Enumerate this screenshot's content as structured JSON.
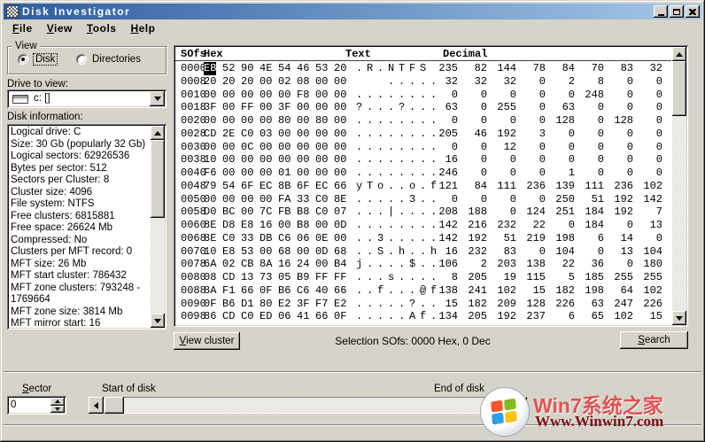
{
  "window": {
    "title": "Disk Investigator"
  },
  "colors": {
    "titlebar_left": "#2d5c9e",
    "titlebar_right": "#a6c8e8",
    "face": "#d6d3ca",
    "selection_bg": "#000000",
    "selection_fg": "#ffffff",
    "watermark_red": "#e05252",
    "watermark_dark_red": "#7b1418"
  },
  "menu": {
    "items": [
      {
        "label": "File"
      },
      {
        "label": "View"
      },
      {
        "label": "Tools"
      },
      {
        "label": "Help"
      }
    ]
  },
  "view_group": {
    "title": "View",
    "options": [
      {
        "label": "Disk",
        "selected": true
      },
      {
        "label": "Directories",
        "selected": false
      }
    ]
  },
  "drive": {
    "label": "Drive to view:",
    "value": "c: []",
    "icon": "drive-icon"
  },
  "disk_info": {
    "label": "Disk information:",
    "lines": [
      "Logical drive: C",
      "Size: 30 Gb (popularly 32 Gb)",
      "Logical sectors: 62926536",
      "Bytes per sector: 512",
      "Sectors per Cluster: 8",
      "Cluster size: 4096",
      "File system: NTFS",
      "Free clusters: 6815881",
      "Free space: 26624 Mb",
      "Compressed: No",
      "Clusters per MFT record: 0",
      "MFT size: 26 Mb",
      "MFT start cluster: 786432",
      "MFT zone clusters: 793248 - 1769664",
      "MFT zone size: 3814 Mb",
      "MFT mirror start: 16"
    ]
  },
  "hexview": {
    "headers": {
      "sofs": "SOfs",
      "hex": "Hex",
      "text": "Text",
      "decimal": "Decimal"
    },
    "selected": {
      "row": 0,
      "col": 0
    },
    "rows": [
      {
        "sofs": "0000",
        "hex": [
          "EB",
          "52",
          "90",
          "4E",
          "54",
          "46",
          "53",
          "20"
        ],
        "text": [
          ".",
          "R",
          ".",
          "N",
          "T",
          "F",
          "S",
          " "
        ],
        "dec": [
          "235",
          "82",
          "144",
          "78",
          "84",
          "70",
          "83",
          "32"
        ]
      },
      {
        "sofs": "0008",
        "hex": [
          "20",
          "20",
          "20",
          "00",
          "02",
          "08",
          "00",
          "00"
        ],
        "text": [
          " ",
          " ",
          " ",
          ".",
          ".",
          ".",
          ".",
          "."
        ],
        "dec": [
          "32",
          "32",
          "32",
          "0",
          "2",
          "8",
          "0",
          "0"
        ]
      },
      {
        "sofs": "0010",
        "hex": [
          "00",
          "00",
          "00",
          "00",
          "00",
          "F8",
          "00",
          "00"
        ],
        "text": [
          ".",
          ".",
          ".",
          ".",
          ".",
          ".",
          ".",
          "."
        ],
        "dec": [
          "0",
          "0",
          "0",
          "0",
          "0",
          "248",
          "0",
          "0"
        ]
      },
      {
        "sofs": "0018",
        "hex": [
          "3F",
          "00",
          "FF",
          "00",
          "3F",
          "00",
          "00",
          "00"
        ],
        "text": [
          "?",
          ".",
          ".",
          ".",
          "?",
          ".",
          ".",
          "."
        ],
        "dec": [
          "63",
          "0",
          "255",
          "0",
          "63",
          "0",
          "0",
          "0"
        ]
      },
      {
        "sofs": "0020",
        "hex": [
          "00",
          "00",
          "00",
          "00",
          "80",
          "00",
          "80",
          "00"
        ],
        "text": [
          ".",
          ".",
          ".",
          ".",
          ".",
          ".",
          ".",
          "."
        ],
        "dec": [
          "0",
          "0",
          "0",
          "0",
          "128",
          "0",
          "128",
          "0"
        ]
      },
      {
        "sofs": "0028",
        "hex": [
          "CD",
          "2E",
          "C0",
          "03",
          "00",
          "00",
          "00",
          "00"
        ],
        "text": [
          ".",
          ".",
          ".",
          ".",
          ".",
          ".",
          ".",
          "."
        ],
        "dec": [
          "205",
          "46",
          "192",
          "3",
          "0",
          "0",
          "0",
          "0"
        ]
      },
      {
        "sofs": "0030",
        "hex": [
          "00",
          "00",
          "0C",
          "00",
          "00",
          "00",
          "00",
          "00"
        ],
        "text": [
          ".",
          ".",
          ".",
          ".",
          ".",
          ".",
          ".",
          "."
        ],
        "dec": [
          "0",
          "0",
          "12",
          "0",
          "0",
          "0",
          "0",
          "0"
        ]
      },
      {
        "sofs": "0038",
        "hex": [
          "10",
          "00",
          "00",
          "00",
          "00",
          "00",
          "00",
          "00"
        ],
        "text": [
          ".",
          ".",
          ".",
          ".",
          ".",
          ".",
          ".",
          "."
        ],
        "dec": [
          "16",
          "0",
          "0",
          "0",
          "0",
          "0",
          "0",
          "0"
        ]
      },
      {
        "sofs": "0040",
        "hex": [
          "F6",
          "00",
          "00",
          "00",
          "01",
          "00",
          "00",
          "00"
        ],
        "text": [
          ".",
          ".",
          ".",
          ".",
          ".",
          ".",
          ".",
          "."
        ],
        "dec": [
          "246",
          "0",
          "0",
          "0",
          "1",
          "0",
          "0",
          "0"
        ]
      },
      {
        "sofs": "0048",
        "hex": [
          "79",
          "54",
          "6F",
          "EC",
          "8B",
          "6F",
          "EC",
          "66"
        ],
        "text": [
          "y",
          "T",
          "o",
          ".",
          ".",
          "o",
          ".",
          "f"
        ],
        "dec": [
          "121",
          "84",
          "111",
          "236",
          "139",
          "111",
          "236",
          "102"
        ]
      },
      {
        "sofs": "0050",
        "hex": [
          "00",
          "00",
          "00",
          "00",
          "FA",
          "33",
          "C0",
          "8E"
        ],
        "text": [
          ".",
          ".",
          ".",
          ".",
          ".",
          "3",
          ".",
          "."
        ],
        "dec": [
          "0",
          "0",
          "0",
          "0",
          "250",
          "51",
          "192",
          "142"
        ]
      },
      {
        "sofs": "0058",
        "hex": [
          "D0",
          "BC",
          "00",
          "7C",
          "FB",
          "B8",
          "C0",
          "07"
        ],
        "text": [
          ".",
          ".",
          ".",
          "|",
          ".",
          ".",
          ".",
          "."
        ],
        "dec": [
          "208",
          "188",
          "0",
          "124",
          "251",
          "184",
          "192",
          "7"
        ]
      },
      {
        "sofs": "0060",
        "hex": [
          "8E",
          "D8",
          "E8",
          "16",
          "00",
          "B8",
          "00",
          "0D"
        ],
        "text": [
          ".",
          ".",
          ".",
          ".",
          ".",
          ".",
          ".",
          "."
        ],
        "dec": [
          "142",
          "216",
          "232",
          "22",
          "0",
          "184",
          "0",
          "13"
        ]
      },
      {
        "sofs": "0068",
        "hex": [
          "8E",
          "C0",
          "33",
          "DB",
          "C6",
          "06",
          "0E",
          "00"
        ],
        "text": [
          ".",
          ".",
          "3",
          ".",
          ".",
          ".",
          ".",
          "."
        ],
        "dec": [
          "142",
          "192",
          "51",
          "219",
          "198",
          "6",
          "14",
          "0"
        ]
      },
      {
        "sofs": "0070",
        "hex": [
          "10",
          "E8",
          "53",
          "00",
          "68",
          "00",
          "0D",
          "68"
        ],
        "text": [
          ".",
          ".",
          "S",
          ".",
          "h",
          ".",
          ".",
          "h"
        ],
        "dec": [
          "16",
          "232",
          "83",
          "0",
          "104",
          "0",
          "13",
          "104"
        ]
      },
      {
        "sofs": "0078",
        "hex": [
          "6A",
          "02",
          "CB",
          "8A",
          "16",
          "24",
          "00",
          "B4"
        ],
        "text": [
          "j",
          ".",
          ".",
          ".",
          ".",
          "$",
          ".",
          "."
        ],
        "dec": [
          "106",
          "2",
          "203",
          "138",
          "22",
          "36",
          "0",
          "180"
        ]
      },
      {
        "sofs": "0080",
        "hex": [
          "08",
          "CD",
          "13",
          "73",
          "05",
          "B9",
          "FF",
          "FF"
        ],
        "text": [
          ".",
          ".",
          ".",
          "s",
          ".",
          ".",
          ".",
          "."
        ],
        "dec": [
          "8",
          "205",
          "19",
          "115",
          "5",
          "185",
          "255",
          "255"
        ]
      },
      {
        "sofs": "0088",
        "hex": [
          "8A",
          "F1",
          "66",
          "0F",
          "B6",
          "C6",
          "40",
          "66"
        ],
        "text": [
          ".",
          ".",
          "f",
          ".",
          ".",
          ".",
          "@",
          "f"
        ],
        "dec": [
          "138",
          "241",
          "102",
          "15",
          "182",
          "198",
          "64",
          "102"
        ]
      },
      {
        "sofs": "0090",
        "hex": [
          "0F",
          "B6",
          "D1",
          "80",
          "E2",
          "3F",
          "F7",
          "E2"
        ],
        "text": [
          ".",
          ".",
          ".",
          ".",
          ".",
          "?",
          ".",
          "."
        ],
        "dec": [
          "15",
          "182",
          "209",
          "128",
          "226",
          "63",
          "247",
          "226"
        ]
      },
      {
        "sofs": "0098",
        "hex": [
          "86",
          "CD",
          "C0",
          "ED",
          "06",
          "41",
          "66",
          "0F"
        ],
        "text": [
          ".",
          ".",
          ".",
          ".",
          ".",
          "A",
          "f",
          "."
        ],
        "dec": [
          "134",
          "205",
          "192",
          "237",
          "6",
          "65",
          "102",
          "15"
        ]
      }
    ]
  },
  "actions": {
    "view_cluster": "View cluster",
    "selection_status": "Selection SOfs: 0000 Hex,  0 Dec",
    "search": "Search"
  },
  "bottom": {
    "sector_label": "Sector",
    "sector_value": "0",
    "start_label": "Start of disk",
    "end_label": "End of disk"
  },
  "watermark": {
    "line1": "Win7系统之家",
    "line2": "Www.Winwin7.com"
  }
}
